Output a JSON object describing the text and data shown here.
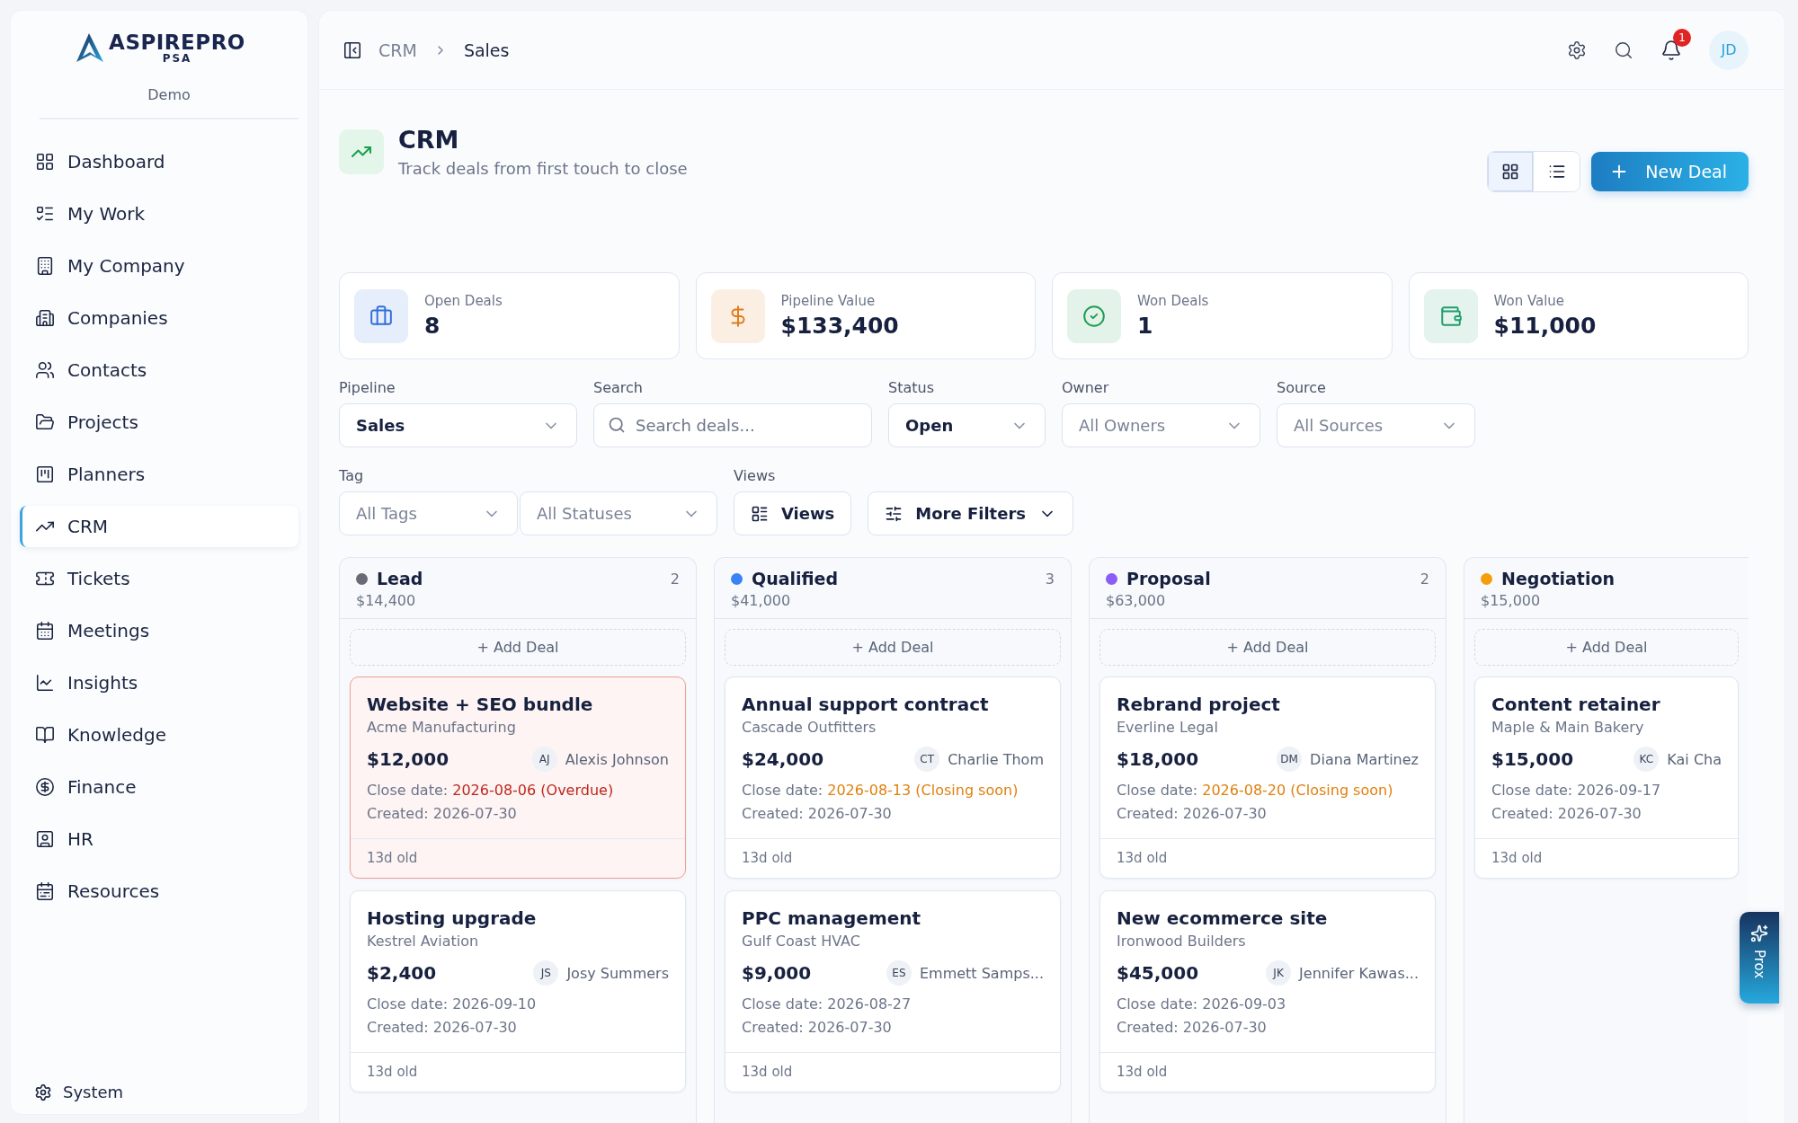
{
  "sidebar": {
    "logo": {
      "name": "ASPIREPRO",
      "sub": "PSA"
    },
    "workspace": "Demo",
    "items": [
      {
        "label": "Dashboard",
        "selected": false
      },
      {
        "label": "My Work",
        "selected": false
      },
      {
        "label": "My Company",
        "selected": false
      },
      {
        "label": "Companies",
        "selected": false
      },
      {
        "label": "Contacts",
        "selected": false
      },
      {
        "label": "Projects",
        "selected": false
      },
      {
        "label": "Planners",
        "selected": false
      },
      {
        "label": "CRM",
        "selected": true
      },
      {
        "label": "Tickets",
        "selected": false
      },
      {
        "label": "Meetings",
        "selected": false
      },
      {
        "label": "Insights",
        "selected": false
      },
      {
        "label": "Knowledge",
        "selected": false
      },
      {
        "label": "Finance",
        "selected": false
      },
      {
        "label": "HR",
        "selected": false
      },
      {
        "label": "Resources",
        "selected": false
      }
    ],
    "footer": "System"
  },
  "header": {
    "breadcrumb": [
      "CRM",
      "Sales"
    ],
    "notifications": "1",
    "avatar": "JD"
  },
  "page": {
    "title": "CRM",
    "subtitle": "Track deals from first touch to close",
    "view_modes": [
      {
        "selected": true
      },
      {
        "selected": false
      }
    ],
    "primary_button": "New Deal"
  },
  "stats": [
    {
      "label": "Open Deals",
      "value": "8",
      "color": "#2f6fdc"
    },
    {
      "label": "Pipeline Value",
      "value": "$133,400",
      "color": "#e07b1a"
    },
    {
      "label": "Won Deals",
      "value": "1",
      "color": "#1e9e52"
    },
    {
      "label": "Won Value",
      "value": "$11,000",
      "color": "#1e9e6a"
    }
  ],
  "filter_rows": [
    [
      {
        "label": "Pipeline",
        "controls": [
          {
            "kind": "select",
            "value": "Sales"
          }
        ]
      },
      {
        "label": "Search",
        "controls": [
          {
            "kind": "search",
            "placeholder": "Search deals..."
          }
        ]
      },
      {
        "label": "Status",
        "controls": [
          {
            "kind": "select",
            "value": "Open"
          }
        ]
      },
      {
        "label": "Owner",
        "controls": [
          {
            "kind": "select",
            "placeholder": "All Owners"
          }
        ]
      },
      {
        "label": "Source",
        "controls": [
          {
            "kind": "select",
            "placeholder": "All Sources"
          }
        ]
      }
    ],
    [
      {
        "label": "Tag",
        "controls": [
          {
            "kind": "select",
            "placeholder": "All Tags"
          },
          {
            "kind": "select",
            "placeholder": "All Statuses"
          }
        ]
      },
      {
        "label": "Views",
        "controls": [
          {
            "kind": "button",
            "text": "Views"
          },
          {
            "kind": "menu",
            "text": "More Filters"
          }
        ]
      }
    ]
  ],
  "board": {
    "stages": [
      {
        "name": "Lead",
        "color": "#6b6b78",
        "count": "2",
        "total": "$14,400",
        "add_label": "+ Add Deal",
        "deals": [
          {
            "title": "Website + SEO bundle",
            "company": "Acme Manufacturing",
            "amount": "$12,000",
            "initials": "AJ",
            "owner": "Alexis Johnson",
            "close_label": "Close date:",
            "close_date": "2026-08-06 (Overdue)",
            "overdue": true,
            "closing_soon": false,
            "created": "Created: 2026-07-30",
            "age": "13d old"
          },
          {
            "title": "Hosting upgrade",
            "company": "Kestrel Aviation",
            "amount": "$2,400",
            "initials": "JS",
            "owner": "Josy Summers",
            "close_label": "Close date:",
            "close_date": "2026-09-10",
            "overdue": false,
            "closing_soon": false,
            "created": "Created: 2026-07-30",
            "age": "13d old"
          }
        ]
      },
      {
        "name": "Qualified",
        "color": "#3b82f6",
        "count": "3",
        "total": "$41,000",
        "add_label": "+ Add Deal",
        "deals": [
          {
            "title": "Annual support contract",
            "company": "Cascade Outfitters",
            "amount": "$24,000",
            "initials": "CT",
            "owner": "Charlie Thom",
            "close_label": "Close date:",
            "close_date": "2026-08-13 (Closing soon)",
            "overdue": false,
            "closing_soon": true,
            "created": "Created: 2026-07-30",
            "age": "13d old"
          },
          {
            "title": "PPC management",
            "company": "Gulf Coast HVAC",
            "amount": "$9,000",
            "initials": "ES",
            "owner": "Emmett Samps...",
            "close_label": "Close date:",
            "close_date": "2026-08-27",
            "overdue": false,
            "closing_soon": false,
            "created": "Created: 2026-07-30",
            "age": "13d old"
          }
        ]
      },
      {
        "name": "Proposal",
        "color": "#8b5cf6",
        "count": "2",
        "total": "$63,000",
        "add_label": "+ Add Deal",
        "deals": [
          {
            "title": "Rebrand project",
            "company": "Everline Legal",
            "amount": "$18,000",
            "initials": "DM",
            "owner": "Diana Martinez",
            "close_label": "Close date:",
            "close_date": "2026-08-20 (Closing soon)",
            "overdue": false,
            "closing_soon": true,
            "created": "Created: 2026-07-30",
            "age": "13d old"
          },
          {
            "title": "New ecommerce site",
            "company": "Ironwood Builders",
            "amount": "$45,000",
            "initials": "JK",
            "owner": "Jennifer Kawas...",
            "close_label": "Close date:",
            "close_date": "2026-09-03",
            "overdue": false,
            "closing_soon": false,
            "created": "Created: 2026-07-30",
            "age": "13d old"
          }
        ]
      },
      {
        "name": "Negotiation",
        "color": "#f59e0b",
        "total": "$15,000",
        "add_label": "+ Add Deal",
        "deals": [
          {
            "title": "Content retainer",
            "company": "Maple & Main Bakery",
            "amount": "$15,000",
            "initials": "KC",
            "owner": "Kai Cha",
            "close_label": "Close date:",
            "close_date": "2026-09-17",
            "overdue": false,
            "closing_soon": false,
            "created": "Created: 2026-07-30",
            "age": "13d old"
          }
        ]
      }
    ]
  },
  "assistant_tab": "Prox"
}
